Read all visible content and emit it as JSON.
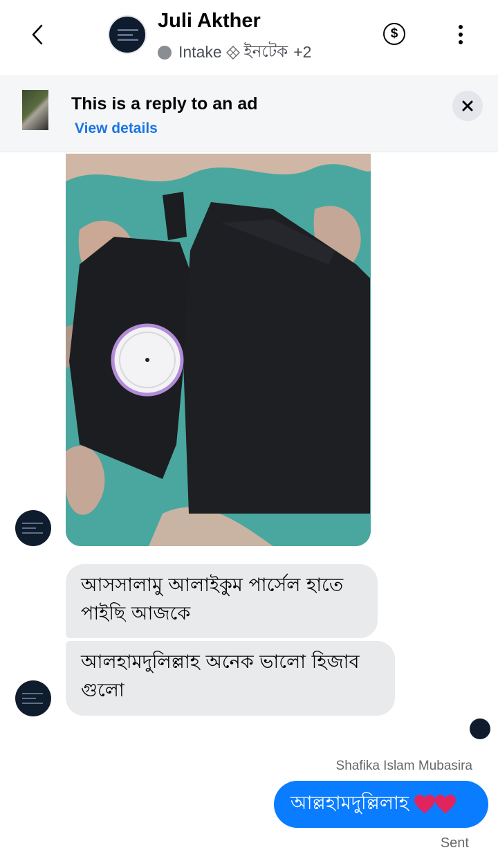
{
  "header": {
    "contact_name": "Juli Akther",
    "status_label": "Intake",
    "tag_label": "ইনটেক",
    "extra_count": "+2"
  },
  "ad_banner": {
    "title": "This is a reply to an ad",
    "link": "View details"
  },
  "messages": [
    {
      "text": "আসসালামু আলাইকুম পার্সেল হাতে পাইছি আজকে"
    },
    {
      "text": "আলহামদুলিল্লাহ অনেক ভালো হিজাব গুলো"
    }
  ],
  "outgoing": {
    "sender": "Shafika Islam Mubasira",
    "text": "আল্লহামদুল্লিলাহ",
    "status": "Sent"
  },
  "colors": {
    "accent": "#0a7cff",
    "link": "#1b74e4",
    "incoming_bubble": "#e9eaec",
    "heart": "#e0245e"
  },
  "icons": [
    "back-arrow-icon",
    "dollar-icon",
    "more-vertical-icon",
    "close-icon",
    "label-icon",
    "heart-icon"
  ]
}
